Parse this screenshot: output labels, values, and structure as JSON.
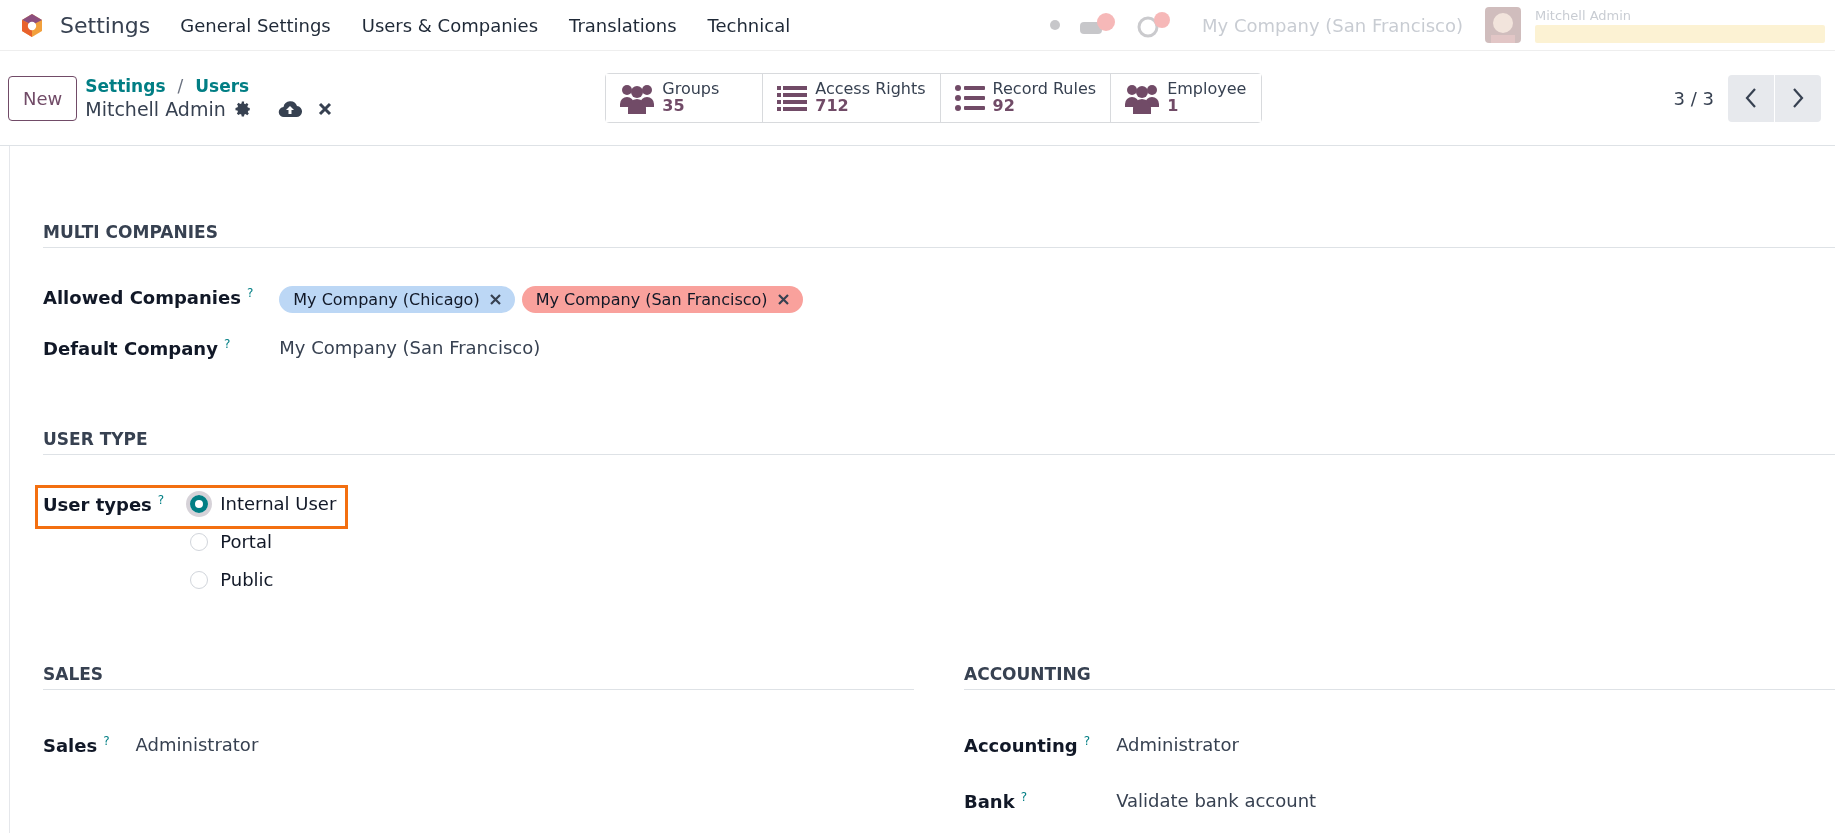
{
  "navbar": {
    "app_name": "Settings",
    "menu": [
      "General Settings",
      "Users & Companies",
      "Translations",
      "Technical"
    ],
    "company": "My Company (San Francisco)",
    "user": "Mitchell Admin"
  },
  "control_panel": {
    "new_button": "New",
    "breadcrumbs": [
      "Settings",
      "Users"
    ],
    "breadcrumb_separator": "/",
    "record_title": "Mitchell Admin",
    "pager": "3 / 3",
    "smart_buttons": [
      {
        "kind": "people",
        "label": "Groups",
        "value": "35"
      },
      {
        "kind": "list",
        "label": "Access Rights",
        "value": "712"
      },
      {
        "kind": "bullets",
        "label": "Record Rules",
        "value": "92"
      },
      {
        "kind": "people",
        "label": "Employee",
        "value": "1"
      }
    ]
  },
  "sections": [
    {
      "title": "MULTI COMPANIES",
      "fields": [
        {
          "kind": "tags",
          "label": "Allowed Companies",
          "help": "?",
          "tags": [
            {
              "text": "My Company (Chicago)",
              "color": "#bcd7f5"
            },
            {
              "text": "My Company (San Francisco)",
              "color": "#f9a19c"
            }
          ]
        },
        {
          "kind": "text",
          "label": "Default Company",
          "help": "?",
          "value": "My Company (San Francisco)"
        }
      ]
    },
    {
      "title": "USER TYPE",
      "fields": [
        {
          "kind": "radio",
          "label": "User types",
          "help": "?",
          "highlighted": true,
          "options": [
            {
              "text": "Internal User",
              "selected": true
            },
            {
              "text": "Portal",
              "selected": false
            },
            {
              "text": "Public",
              "selected": false
            }
          ]
        }
      ]
    }
  ],
  "columns": [
    {
      "title": "SALES",
      "fields": [
        {
          "kind": "text",
          "label": "Sales",
          "help": "?",
          "value": "Administrator"
        }
      ]
    },
    {
      "title": "ACCOUNTING",
      "fields": [
        {
          "kind": "text",
          "label": "Accounting",
          "help": "?",
          "value": "Administrator"
        },
        {
          "kind": "text",
          "label": "Bank",
          "help": "?",
          "value": "Validate bank account"
        }
      ]
    }
  ]
}
